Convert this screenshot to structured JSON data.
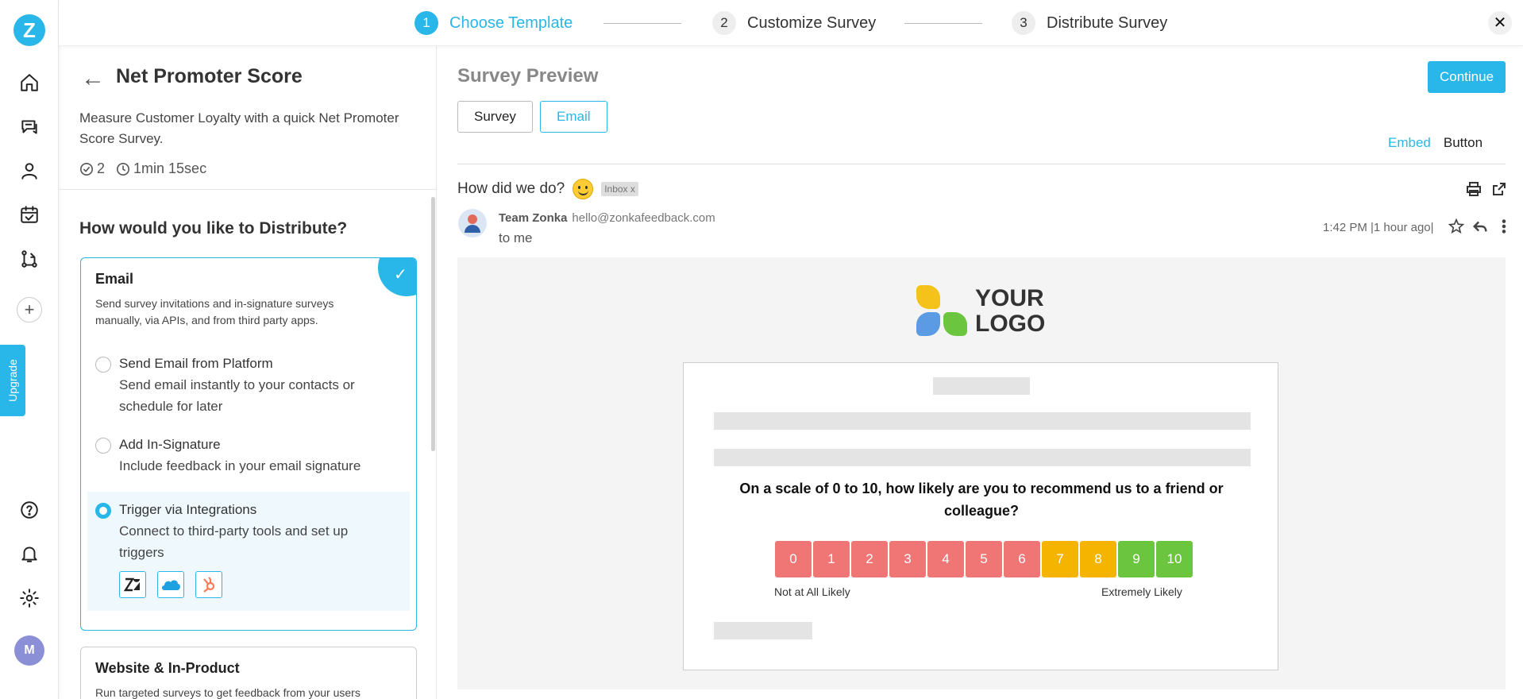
{
  "app": {
    "logo_letter": "Z",
    "avatar_initial": "M",
    "upgrade_label": "Upgrade",
    "plus_symbol": "+"
  },
  "stepper": {
    "steps": [
      {
        "num": "1",
        "label": "Choose Template",
        "active": true
      },
      {
        "num": "2",
        "label": "Customize Survey",
        "active": false
      },
      {
        "num": "3",
        "label": "Distribute Survey",
        "active": false
      }
    ],
    "close_symbol": "✕"
  },
  "template": {
    "title": "Net Promoter Score",
    "description": "Measure Customer Loyalty with a quick Net Promoter Score Survey.",
    "question_count": "2",
    "duration": "1min 15sec"
  },
  "distribute": {
    "question": "How would you like to Distribute?",
    "email_card": {
      "title": "Email",
      "description": "Send survey invitations and in-signature surveys manually, via APIs, and from third party apps.",
      "options": [
        {
          "title": "Send Email from Platform",
          "desc": "Send email instantly to your contacts or schedule for later",
          "selected": false
        },
        {
          "title": "Add In-Signature",
          "desc": "Include feedback in your email signature",
          "selected": false
        },
        {
          "title": "Trigger via Integrations",
          "desc": "Connect to third-party tools and set up triggers",
          "selected": true
        }
      ],
      "integrations": [
        "zendesk-icon",
        "salesforce-icon",
        "hubspot-icon"
      ]
    },
    "website_card": {
      "title": "Website & In-Product",
      "description": "Run targeted surveys to get feedback from your users"
    }
  },
  "preview": {
    "title": "Survey Preview",
    "continue_label": "Continue",
    "tabs": [
      "Survey",
      "Email"
    ],
    "active_tab": "Email",
    "embed_label": "Embed",
    "button_label": "Button"
  },
  "email": {
    "subject": "How did we do?",
    "inbox_tag": "Inbox x",
    "sender_name": "Team Zonka",
    "sender_email": "hello@zonkafeedback.com",
    "to": "to me",
    "time": "1:42 PM |1 hour ago|",
    "logo_line1": "YOUR",
    "logo_line2": "LOGO",
    "question": "On a scale of 0 to 10, how likely are you to recommend us to a friend or colleague?",
    "scale": [
      "0",
      "1",
      "2",
      "3",
      "4",
      "5",
      "6",
      "7",
      "8",
      "9",
      "10"
    ],
    "low_label": "Not at All Likely",
    "high_label": "Extremely Likely"
  },
  "colors": {
    "accent": "#28b7e8",
    "detractor": "#f07575",
    "passive": "#f5b400",
    "promoter": "#6cc53f"
  }
}
